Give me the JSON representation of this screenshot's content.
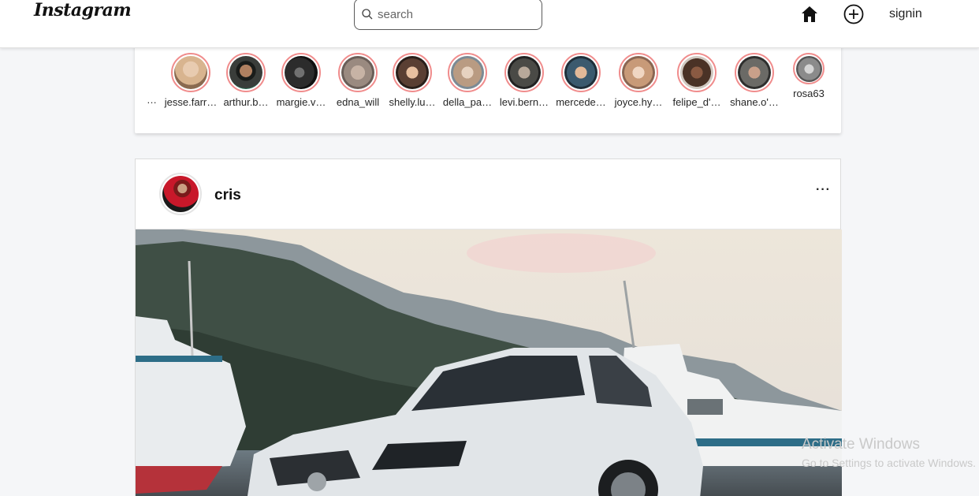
{
  "header": {
    "logo": "Instagram",
    "search_placeholder": "search",
    "signin_label": "signin"
  },
  "stories": [
    {
      "username": "jesse.farr…",
      "color": "#d8b48f"
    },
    {
      "username": "arthur.b…",
      "color": "#3a3d3a"
    },
    {
      "username": "margie.v…",
      "color": "#2c2c2c"
    },
    {
      "username": "edna_will",
      "color": "#9a8a80"
    },
    {
      "username": "shelly.lu…",
      "color": "#5a3f33"
    },
    {
      "username": "della_pa…",
      "color": "#b99b82"
    },
    {
      "username": "levi.bern…",
      "color": "#4a4a46"
    },
    {
      "username": "mercede…",
      "color": "#3b5a6e"
    },
    {
      "username": "joyce.hy…",
      "color": "#c89a78"
    },
    {
      "username": "felipe_d'…",
      "color": "#4a3226"
    },
    {
      "username": "shane.o'…",
      "color": "#6b6a66"
    },
    {
      "username": "rosa63",
      "color": "#8b8b8b"
    }
  ],
  "stories_clip_text": "…",
  "post": {
    "username": "cris",
    "more_label": "···",
    "image_alt": "white station wagon parked by a lake with boats and mountains"
  },
  "watermark": {
    "line1": "Activate Windows",
    "line2": "Go to Settings to activate Windows."
  }
}
